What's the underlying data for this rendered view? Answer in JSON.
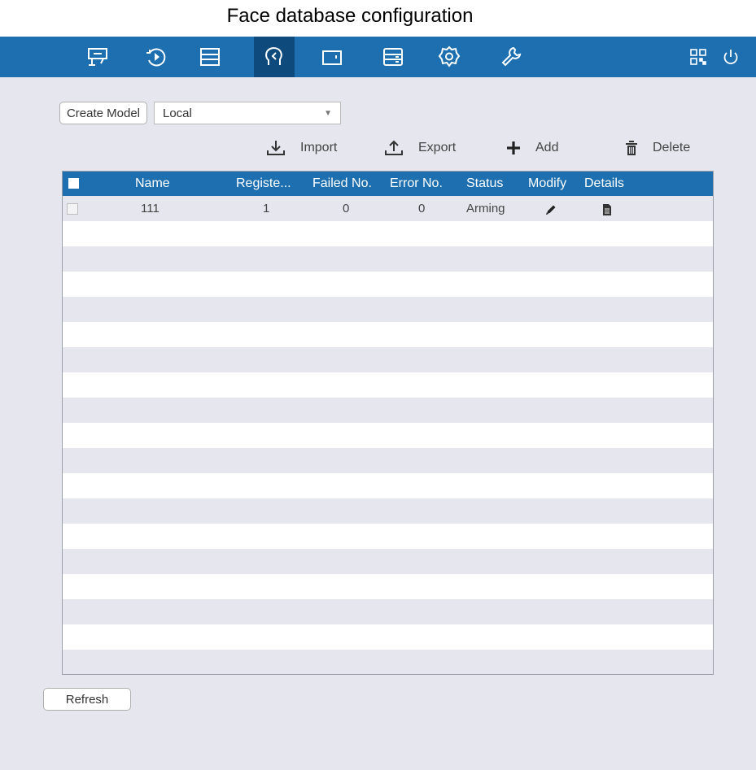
{
  "page_title": "Face database configuration",
  "topbar": {
    "background": "#1d6fb0",
    "items": [
      {
        "icon": "live-view-icon"
      },
      {
        "icon": "playback-icon"
      },
      {
        "icon": "file-management-icon"
      },
      {
        "icon": "smart-analysis-icon",
        "active": true
      },
      {
        "icon": "camera-icon"
      },
      {
        "icon": "storage-icon"
      },
      {
        "icon": "system-settings-icon"
      },
      {
        "icon": "maintenance-icon"
      }
    ],
    "right_icons": [
      "qr-code-icon",
      "power-icon"
    ]
  },
  "toolbar": {
    "create_model_label": "Create Model",
    "model_select_value": "Local",
    "import_label": "Import",
    "export_label": "Export",
    "add_label": "Add",
    "delete_label": "Delete"
  },
  "table": {
    "columns": [
      "Name",
      "Registe...",
      "Failed No.",
      "Error No.",
      "Status",
      "Modify",
      "Details"
    ],
    "rows": [
      {
        "name": "111",
        "registered": "1",
        "failed": "0",
        "error": "0",
        "status": "Arming",
        "modify_icon": "pencil-icon",
        "details_icon": "document-icon"
      }
    ]
  },
  "footer": {
    "refresh_label": "Refresh"
  }
}
